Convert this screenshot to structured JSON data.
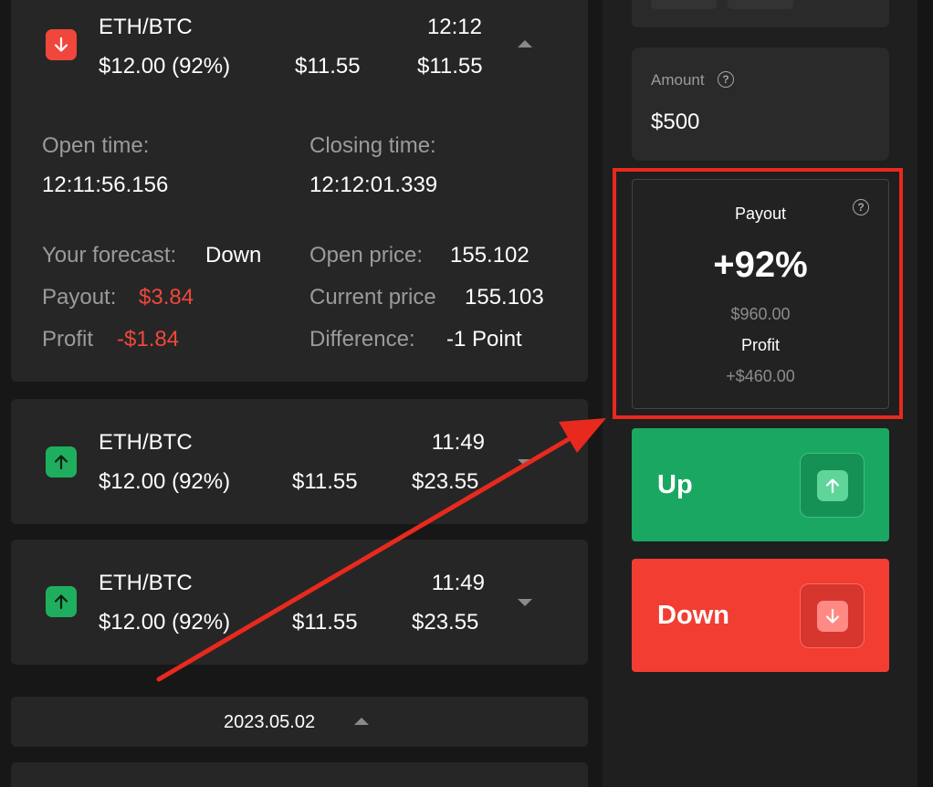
{
  "trades": [
    {
      "pair": "ETH/BTC",
      "time": "12:12",
      "amount_payout": "$12.00 (92%)",
      "value1": "$11.55",
      "value2": "$11.55",
      "direction": "down",
      "expanded": true,
      "details": {
        "open_time_label": "Open time:",
        "open_time": "12:11:56.156",
        "closing_time_label": "Closing time:",
        "closing_time": "12:12:01.339",
        "forecast_label": "Your forecast:",
        "forecast": "Down",
        "payout_label": "Payout:",
        "payout": "$3.84",
        "profit_label": "Profit",
        "profit": "-$1.84",
        "open_price_label": "Open price:",
        "open_price": "155.102",
        "current_price_label": "Current price",
        "current_price": "155.103",
        "difference_label": "Difference:",
        "difference": "-1 Point"
      }
    },
    {
      "pair": "ETH/BTC",
      "time": "11:49",
      "amount_payout": "$12.00 (92%)",
      "value1": "$11.55",
      "value2": "$23.55",
      "direction": "up",
      "expanded": false
    },
    {
      "pair": "ETH/BTC",
      "time": "11:49",
      "amount_payout": "$12.00 (92%)",
      "value1": "$11.55",
      "value2": "$23.55",
      "direction": "up",
      "expanded": false
    }
  ],
  "date_group": "2023.05.02",
  "panel": {
    "amount_label": "Amount",
    "amount_value": "$500",
    "payout_label": "Payout",
    "payout_percent": "+92%",
    "payout_total": "$960.00",
    "profit_label": "Profit",
    "profit_value": "+$460.00",
    "up_label": "Up",
    "down_label": "Down"
  },
  "colors": {
    "up": "#1aa762",
    "down": "#f23d32",
    "annotation": "#e8291e"
  }
}
